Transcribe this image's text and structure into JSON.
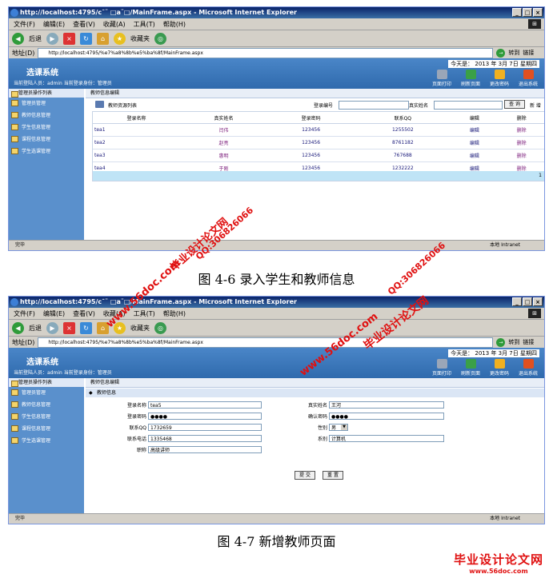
{
  "browser": {
    "title": "http://localhost:4795/c¯¨ □a¨□/MainFrame.aspx - Microsoft Internet Explorer",
    "menu": [
      "文件(F)",
      "编辑(E)",
      "查看(V)",
      "收藏(A)",
      "工具(T)",
      "帮助(H)"
    ],
    "back_label": "后退",
    "favorites_label": "收藏夹",
    "address_label": "地址(D)",
    "address": "http://localhost:4795/%e7%a8%8b%e5%ba%8f/MainFrame.aspx",
    "go_label": "转到",
    "links_label": "链接",
    "status_done": "完毕",
    "status_zone": "本地 Intranet"
  },
  "app": {
    "date_label": "今天是： 2013 年 3月 7日 星期四",
    "system_name": "选课系统",
    "user_info": "当前登陆人员：admin 当前登录身份：管理员",
    "header_icons": [
      {
        "name": "page-print-icon",
        "label": "页面打印",
        "color": "#9aa6b8"
      },
      {
        "name": "refresh-icon",
        "label": "刷新页面",
        "color": "#3aa048"
      },
      {
        "name": "key-icon",
        "label": "更改密码",
        "color": "#f0b020"
      },
      {
        "name": "exit-icon",
        "label": "退出系统",
        "color": "#e05020"
      }
    ],
    "sidebar_head": "管理员操作列表",
    "sidebar_items": [
      "管理员管理",
      "教师信息管理",
      "学生信息管理",
      "课程信息管理",
      "学生选课管理"
    ]
  },
  "screen1": {
    "crumb": "教师信息编辑",
    "list_title": "教师资源列表",
    "search_login_label": "登录编号",
    "search_name_label": "真实姓名",
    "query_button": "查 询",
    "add_button": "新 增",
    "columns": [
      "登录名称",
      "真实姓名",
      "登录密码",
      "联系QQ",
      "编辑",
      "删除"
    ],
    "rows": [
      [
        "tea1",
        "闫伟",
        "123456",
        "1255502",
        "编辑",
        "删除"
      ],
      [
        "tea2",
        "赵亮",
        "123456",
        "8761182",
        "编辑",
        "删除"
      ],
      [
        "tea3",
        "惠明",
        "123456",
        "767688",
        "编辑",
        "删除"
      ],
      [
        "tea4",
        "于刚",
        "123456",
        "1232222",
        "编辑",
        "删除"
      ]
    ],
    "page_number": "1"
  },
  "caption1": "图 4-6 录入学生和教师信息",
  "screen2": {
    "crumb": "教师信息编辑",
    "section_title": "教师信息",
    "fields_left": [
      {
        "label": "登录名称",
        "value": "tea5"
      },
      {
        "label": "登录密码",
        "value": "●●●●"
      },
      {
        "label": "联系QQ",
        "value": "1732659"
      },
      {
        "label": "联系电话",
        "value": "1335468"
      },
      {
        "label": "职称",
        "value": "高级讲师"
      }
    ],
    "fields_right": [
      {
        "label": "真实姓名",
        "value": "王河"
      },
      {
        "label": "确认密码",
        "value": "●●●●"
      },
      {
        "label": "性别",
        "value": "男"
      },
      {
        "label": "系别",
        "value": "计算机"
      }
    ],
    "submit_button": "提 交",
    "reset_button": "重 置"
  },
  "caption2": "图 4-7 新增教师页面",
  "watermarks": [
    "毕业设计论文网",
    "QQ:306826066",
    "www.56doc.com"
  ],
  "logo": {
    "title": "毕业设计论文网",
    "url": "www.56doc.com"
  }
}
